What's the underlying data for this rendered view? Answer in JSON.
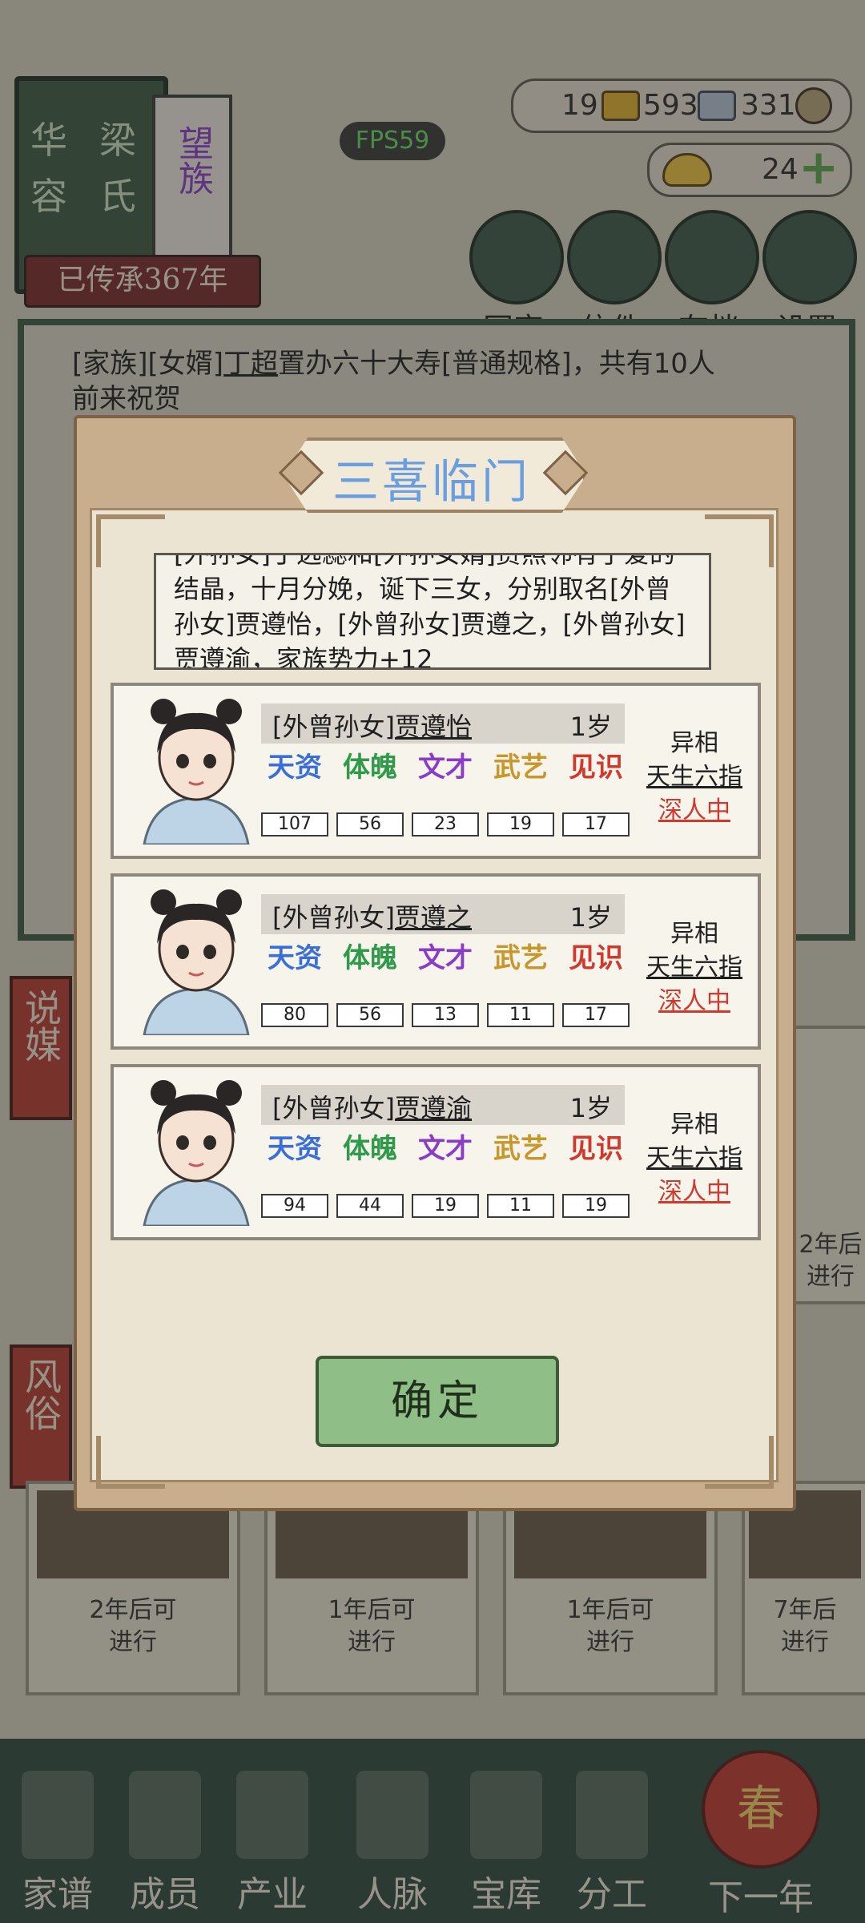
{
  "clan": {
    "name_chars": [
      "华",
      "容",
      "梁",
      "氏"
    ],
    "rank": "望族",
    "inherit_label": "已传承367年"
  },
  "resources": {
    "gold_bars": "19",
    "silver_bars": "593",
    "coins": "331",
    "ingots": "24"
  },
  "fps": "FPS59",
  "top_buttons": [
    {
      "label": "同宗"
    },
    {
      "label": "信件"
    },
    {
      "label": "存档"
    },
    {
      "label": "设置"
    }
  ],
  "log": {
    "prefix1": "[家族][女婿]",
    "name": "丁超",
    "rest": "置办六十大寿[普通规格]，共有10人",
    "line2": "前来祝贺"
  },
  "side_tabs": {
    "matchmaking": "说媒",
    "customs": "风俗"
  },
  "bg_cards": [
    {
      "text1": "2年后可",
      "text2": "进行"
    },
    {
      "text1": "1年后可",
      "text2": "进行"
    },
    {
      "text1": "1年后可",
      "text2": "进行"
    },
    {
      "text1": "7年后",
      "text2": "进行"
    }
  ],
  "bg_card_right_mid": {
    "text1": "2年后",
    "text2": "进行"
  },
  "nav": [
    {
      "label": "家谱"
    },
    {
      "label": "成员"
    },
    {
      "label": "产业"
    },
    {
      "label": "人脉"
    },
    {
      "label": "宝库"
    },
    {
      "label": "分工"
    },
    {
      "label": "下一年"
    }
  ],
  "spring_char": "春",
  "modal": {
    "title": "三喜临门",
    "desc_lines": [
      "[外孙女]丁远蕊和[外孙女婿]贾照邻有了爱的",
      "结晶，十月分娩，诞下三女，分别取名[外曾",
      "孙女]贾遵怡，[外曾孙女]贾遵之，[外曾孙女]",
      "贾遵渝，家族势力+12"
    ],
    "stat_labels": [
      "天资",
      "体魄",
      "文才",
      "武艺",
      "见识"
    ],
    "stat_colors": [
      "#3a6fd8",
      "#2f9a4a",
      "#8a3cc8",
      "#c8962a",
      "#d03a2e"
    ],
    "children": [
      {
        "prefix": "[外曾孙女]",
        "name": "贾遵怡",
        "age": "1岁",
        "stats": [
          "107",
          "56",
          "23",
          "19",
          "17"
        ],
        "trait_title": "异相",
        "trait": "天生六指",
        "status": "深人中"
      },
      {
        "prefix": "[外曾孙女]",
        "name": "贾遵之",
        "age": "1岁",
        "stats": [
          "80",
          "56",
          "13",
          "11",
          "17"
        ],
        "trait_title": "异相",
        "trait": "天生六指",
        "status": "深人中"
      },
      {
        "prefix": "[外曾孙女]",
        "name": "贾遵渝",
        "age": "1岁",
        "stats": [
          "94",
          "44",
          "19",
          "11",
          "19"
        ],
        "trait_title": "异相",
        "trait": "天生六指",
        "status": "深人中"
      }
    ],
    "confirm": "确定"
  }
}
